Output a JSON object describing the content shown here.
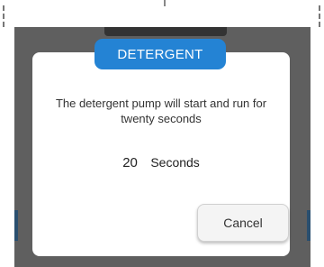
{
  "dialog": {
    "title": "DETERGENT",
    "message": "The detergent  pump will start and run for twenty seconds",
    "countdown_value": "20",
    "countdown_unit": "Seconds",
    "cancel_label": "Cancel"
  },
  "colors": {
    "accent": "#2483d4",
    "overlay": "#5f5f5f",
    "dialog_bg": "#ffffff"
  }
}
